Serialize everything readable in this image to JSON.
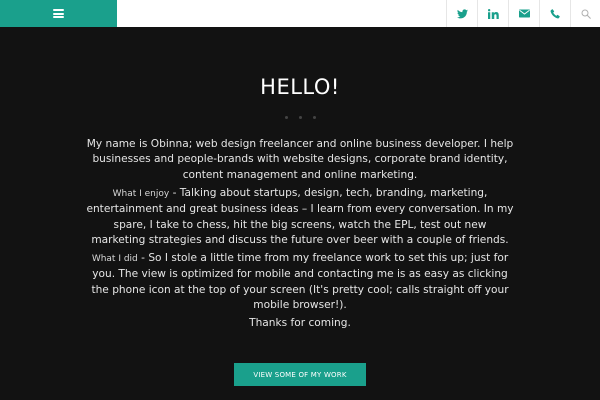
{
  "header": {
    "menu_icon": "hamburger-icon",
    "icons": [
      "twitter-icon",
      "linkedin-icon",
      "envelope-icon",
      "phone-icon",
      "search-icon"
    ],
    "accent_color": "#1aa08c"
  },
  "main": {
    "title": "HELLO!",
    "para1": "My name is Obinna; web design freelancer and online business developer. I help businesses and people-brands with website designs, corporate brand identity, content management and online marketing.",
    "para2_lead": "What I enjoy",
    "para2_body": " - Talking about startups, design, tech, branding, marketing, entertainment and great business ideas – I learn from every conversation. In my spare, I take to chess, hit the big screens, watch the EPL, test out new marketing strategies and discuss the future over beer with a couple of friends.",
    "para3_lead": "What I did",
    "para3_body": " - So I stole a little time from my freelance work to set this up; just for you. The view is optimized for mobile and contacting me is as easy as clicking the phone icon at the top of your screen (It's pretty cool; calls straight off your mobile browser!).",
    "para4": "Thanks for coming.",
    "cta_label": "VIEW SOME OF MY WORK"
  }
}
